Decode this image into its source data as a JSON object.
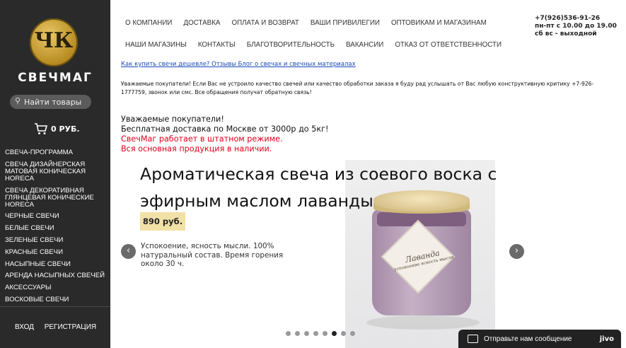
{
  "sidebar": {
    "logo_text": "ЧК",
    "brand": "СВЕЧМАГ",
    "search_placeholder": "Найти товары",
    "cart_total": "0 РУБ.",
    "menu": [
      "СВЕЧА-ПРОГРАММА",
      "СВЕЧА ДИЗАЙНЕРСКАЯ МАТОВАЯ КОНИЧЕСКАЯ HORECA",
      "СВЕЧА ДЕКОРАТИВНАЯ ГЛЯНЦЕВАЯ КОНИЧЕСКИЕ HORECA",
      "ЧЕРНЫЕ СВЕЧИ",
      "БЕЛЫЕ СВЕЧИ",
      "ЗЕЛЕНЫЕ СВЕЧИ",
      "КРАСНЫЕ СВЕЧИ",
      "НАСЫПНЫЕ СВЕЧИ",
      "АРЕНДА НАСЫПНЫХ СВЕЧЕЙ",
      "АКСЕССУАРЫ",
      "ВОСКОВЫЕ СВЕЧИ"
    ],
    "login": "ВХОД",
    "register": "РЕГИСТРАЦИЯ"
  },
  "topnav": {
    "row1": [
      "О КОМПАНИИ",
      "ДОСТАВКА",
      "ОПЛАТА И ВОЗВРАТ",
      "ВАШИ ПРИВИЛЕГИИ",
      "ОПТОВИКАМ И МАГАЗИНАМ"
    ],
    "row2": [
      "НАШИ МАГАЗИНЫ",
      "КОНТАКТЫ",
      "БЛАГОТВОРИТЕЛЬНОСТЬ",
      "ВАКАНСИИ",
      "ОТКАЗ ОТ ОТВЕТСТВЕННОСТИ"
    ]
  },
  "contacts": {
    "phone": "+7(926)536-91-26",
    "hours": "пн-пт с 10.00 до 19.00",
    "weekend": "сб вс - выходной"
  },
  "sublinks": [
    "Как купить свечи дешевле?",
    "Отзывы",
    "Блог о свечах и свечных материалах"
  ],
  "notice": "Уважаемые покупатели! Если Вас не устроило качество свечей или качество обработки заказа я буду рад услышать от Вас любую конструктивную критику +7-926-1777759, звонок или смс. Все обращения получат обратную связь!",
  "announcement": {
    "line1": "Уважаемые покупатели!",
    "line2": "Бесплатная доставка по Москве от 3000р до 5кг!",
    "line3": "СвечМаг работает в штатном режиме.",
    "line4": "Вся основная продукция в наличии."
  },
  "slide": {
    "title": "Ароматическая свеча из соевого воска с эфирным маслом лаванды",
    "price": "890 руб.",
    "description": "Успокоение, ясность мысли. 100% натуральный состав. Время горения около 30 ч.",
    "label_title": "Лаванда",
    "label_sub": "успокоение ясность мысли",
    "total_slides": 8,
    "active_slide": 6
  },
  "arrows": {
    "prev": "‹",
    "next": "›"
  },
  "chat": {
    "text": "Отправьте нам сообщение",
    "brand": "jivo"
  },
  "colors": {
    "sidebar": "#2a2a2a",
    "accent_red": "#e0001b",
    "link": "#1a4ab7",
    "price_bg": "#f1e1a6"
  }
}
